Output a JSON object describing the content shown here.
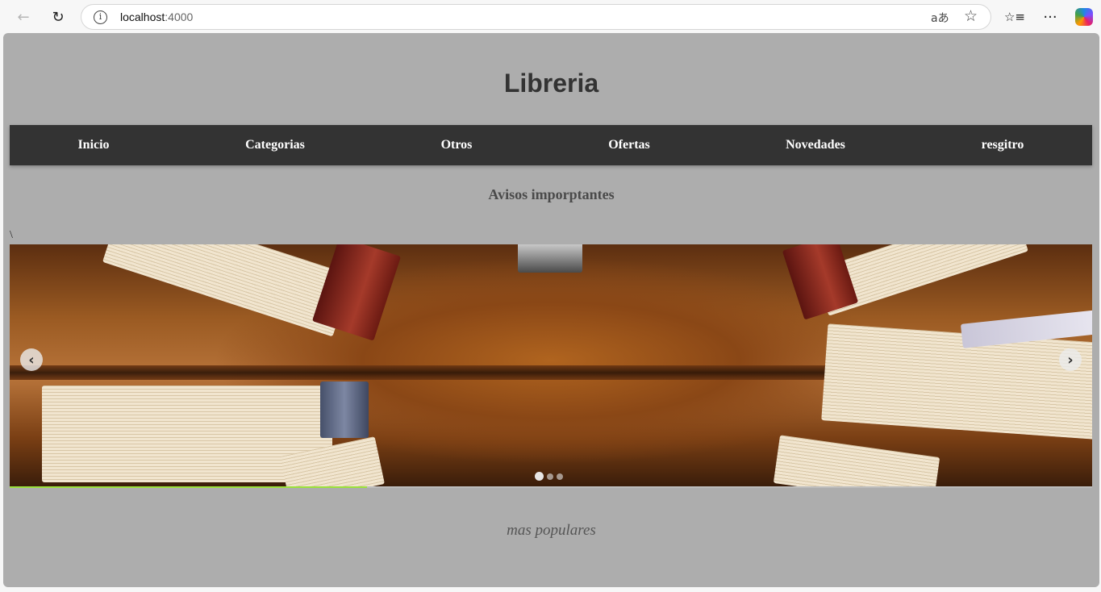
{
  "browser": {
    "url_host": "localhost",
    "url_port": ":4000",
    "info_icon": "info-icon",
    "back_icon": "back-arrow-icon",
    "reload_icon": "reload-icon",
    "translate_icon": "translate-icon",
    "favorite_icon": "star-icon",
    "favorites_icon": "favorites-icon",
    "more_icon": "more-icon",
    "copilot_icon": "copilot-icon",
    "back_glyph": "←",
    "reload_glyph": "↻",
    "info_glyph": "i",
    "translate_glyph": "aあ",
    "star_glyph": "☆",
    "favorites_glyph": "☆≡",
    "more_glyph": "···"
  },
  "site": {
    "title": "Libreria",
    "nav": [
      "Inicio",
      "Categorias",
      "Otros",
      "Ofertas",
      "Novedades",
      "resgitro"
    ],
    "notice": "Avisos imporptantes",
    "stray_text": "\\",
    "carousel": {
      "prev_glyph": "‹",
      "next_glyph": "›",
      "slide_count": 3,
      "active_slide": 1,
      "progress": 0.33
    },
    "section_title": "mas populares"
  },
  "colors": {
    "page_bg": "#adadad",
    "navbar_bg": "#333333",
    "progress_fill": "#9be23c"
  }
}
